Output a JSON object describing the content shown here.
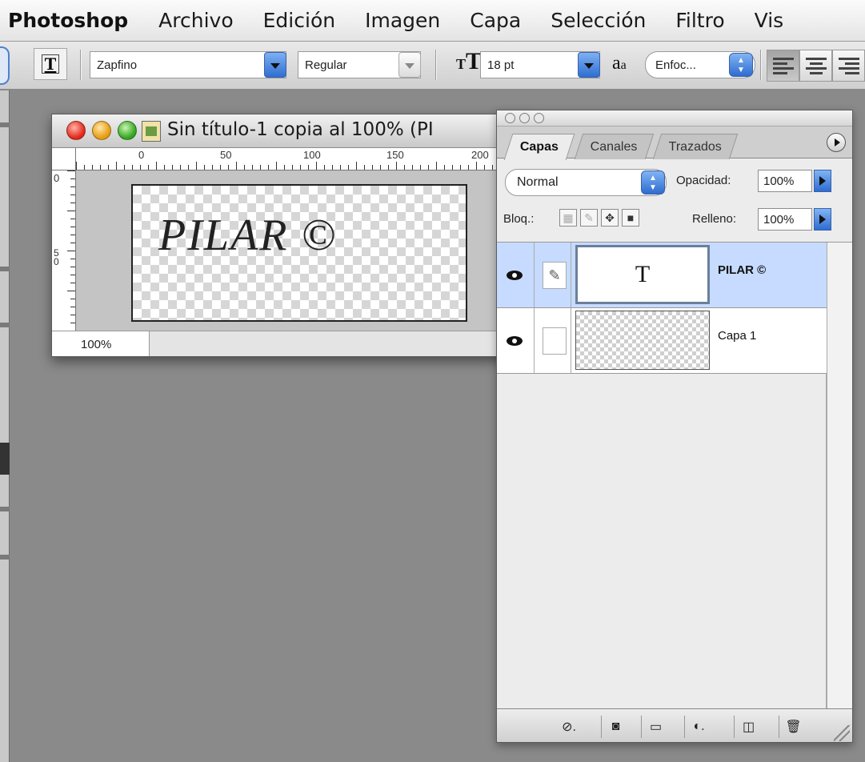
{
  "menubar": {
    "app_name": "Photoshop",
    "items": [
      "Archivo",
      "Edición",
      "Imagen",
      "Capa",
      "Selección",
      "Filtro",
      "Vis"
    ]
  },
  "options_bar": {
    "font_family": "Zapfino",
    "font_style": "Regular",
    "font_size": "18 pt",
    "antialias": "Enfoc...",
    "tool_icon": "text-tool-icon"
  },
  "document": {
    "title": "Sin título-1 copia al 100% (PI",
    "zoom": "100%",
    "canvas_text": "PILAR ©",
    "ruler_h_labels": [
      "0",
      "50",
      "100",
      "150",
      "200"
    ],
    "ruler_v_labels": [
      "0",
      "5 0"
    ]
  },
  "layers_palette": {
    "tabs": [
      "Capas",
      "Canales",
      "Trazados"
    ],
    "active_tab": "Capas",
    "blend_mode": "Normal",
    "opacity_label": "Opacidad:",
    "opacity_value": "100%",
    "lock_label": "Bloq.:",
    "fill_label": "Relleno:",
    "fill_value": "100%",
    "layers": [
      {
        "name": "PILAR ©",
        "thumb_text": "T",
        "selected": true,
        "visible": true
      },
      {
        "name": "Capa 1",
        "selected": false,
        "visible": true
      }
    ],
    "bottom_icons": [
      "link-layers-icon",
      "layer-mask-icon",
      "new-group-icon",
      "adjustment-layer-icon",
      "new-layer-icon",
      "trash-icon"
    ]
  },
  "colors": {
    "workspace_bg": "#8a8a8a",
    "selection_blue": "#c6dbff",
    "aqua_button": "#2e6cd0"
  }
}
